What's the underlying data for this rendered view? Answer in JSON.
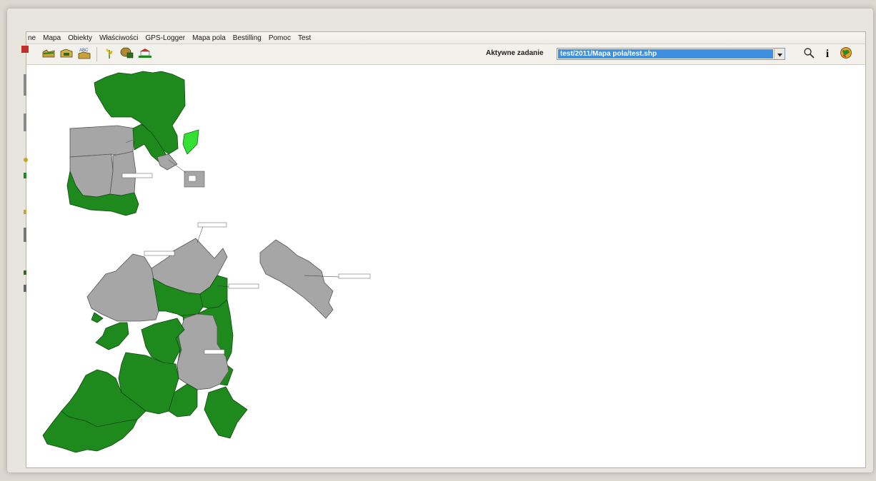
{
  "menu": {
    "items": [
      "ne",
      "Mapa",
      "Obiekty",
      "Właściwości",
      "GPS-Logger",
      "Mapa pola",
      "Bestilling",
      "Pomoc",
      "Test"
    ]
  },
  "toolbar": {
    "buttons": [
      {
        "name": "open-field-icon"
      },
      {
        "name": "save-field-icon"
      },
      {
        "name": "abc-label-icon",
        "text": "ABC"
      },
      {
        "name": "crop-plant-icon"
      },
      {
        "name": "soil-sample-icon"
      },
      {
        "name": "farm-building-icon"
      }
    ],
    "task_label": "Aktywne zadanie",
    "task_value": "test/2011/Mapa pola/test.shp",
    "right_buttons": [
      {
        "name": "zoom-search-icon"
      },
      {
        "name": "info-icon",
        "text": "i"
      },
      {
        "name": "map-globe-icon"
      }
    ]
  },
  "colors": {
    "field_green": "#1e8a1e",
    "field_gray": "#a6a6a6",
    "selected_green": "#33e033",
    "task_highlight": "#3e8fe0"
  }
}
